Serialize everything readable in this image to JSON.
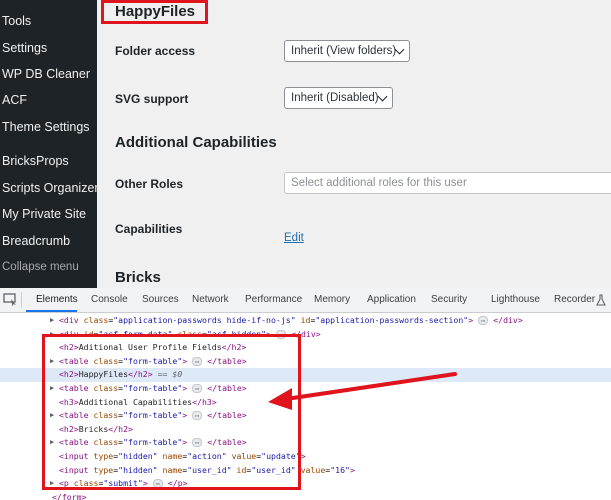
{
  "sidebar": {
    "items": [
      {
        "label": "Tools"
      },
      {
        "label": "Settings"
      },
      {
        "label": "WP DB Cleaner"
      },
      {
        "label": "ACF"
      },
      {
        "label": "Theme Settings"
      },
      {
        "label": "BricksProps"
      },
      {
        "label": "Scripts Organizer"
      },
      {
        "label": "My Private Site"
      },
      {
        "label": "Breadcrumb"
      }
    ],
    "collapse_label": "Collapse menu"
  },
  "main": {
    "happyfiles_heading": "HappyFiles",
    "folder_access": {
      "label": "Folder access",
      "value": "Inherit (View folders)"
    },
    "svg_support": {
      "label": "SVG support",
      "value": "Inherit (Disabled)"
    },
    "capabilities_heading": "Additional Capabilities",
    "other_roles": {
      "label": "Other Roles",
      "placeholder": "Select additional roles for this user"
    },
    "capabilities": {
      "label": "Capabilities",
      "link": "Edit"
    },
    "bricks_heading": "Bricks"
  },
  "devtools": {
    "tabs": [
      "Elements",
      "Console",
      "Sources",
      "Network",
      "Performance",
      "Memory",
      "Application",
      "Security",
      "Lighthouse",
      "Recorder"
    ],
    "active_tab": "Elements",
    "ellipsis": "⋯",
    "dom": {
      "l1": {
        "open": "<div ",
        "a1": "class",
        "v1": "\"application-passwords hide-if-no-js\"",
        "a2": "id",
        "v2": "\"application-passwords-section\"",
        "close": "</div>"
      },
      "l2": {
        "open": "<div ",
        "a1": "id",
        "v1": "\"acf-form-data\"",
        "a2": "class",
        "v2": "\"acf-hidden\"",
        "close": "</div>"
      },
      "l3": {
        "open": "<h2>",
        "text": "Aditional User Profile Fields",
        "close": "</h2>"
      },
      "l4": {
        "open": "<table ",
        "a1": "class",
        "v1": "\"form-table\"",
        "close": "</table>"
      },
      "l5": {
        "open": "<h2>",
        "text": "HappyFiles",
        "close": "</h2>",
        "marker": "== $0"
      },
      "l6": {
        "open": "<table ",
        "a1": "class",
        "v1": "\"form-table\"",
        "close": "</table>"
      },
      "l7": {
        "open": "<h3>",
        "text": "Additional Capabilities",
        "close": "</h3>"
      },
      "l8": {
        "open": "<table ",
        "a1": "class",
        "v1": "\"form-table\"",
        "close": "</table>"
      },
      "l9": {
        "open": "<h2>",
        "text": "Bricks",
        "close": "</h2>"
      },
      "l10": {
        "open": "<table ",
        "a1": "class",
        "v1": "\"form-table\"",
        "close": "</table>"
      },
      "l11": {
        "open": "<input ",
        "a1": "type",
        "v1": "\"hidden\"",
        "a2": "name",
        "v2": "\"action\"",
        "a3": "value",
        "v3": "\"update\"",
        "close": ">"
      },
      "l12": {
        "open": "<input ",
        "a1": "type",
        "v1": "\"hidden\"",
        "a2": "name",
        "v2": "\"user_id\"",
        "a3": "id",
        "v3": "\"user_id\"",
        "a4": "value",
        "v4": "\"16\"",
        "close": ">"
      },
      "l13": {
        "open": "<p ",
        "a1": "class",
        "v1": "\"submit\"",
        "close": "</p>"
      },
      "l14": {
        "text": "</form>"
      }
    }
  },
  "colors": {
    "annotation_red": "#e0141c",
    "arrow_red": "#e0141c",
    "selection": "#dde9f7",
    "sidebar_bg": "#1d2327"
  }
}
